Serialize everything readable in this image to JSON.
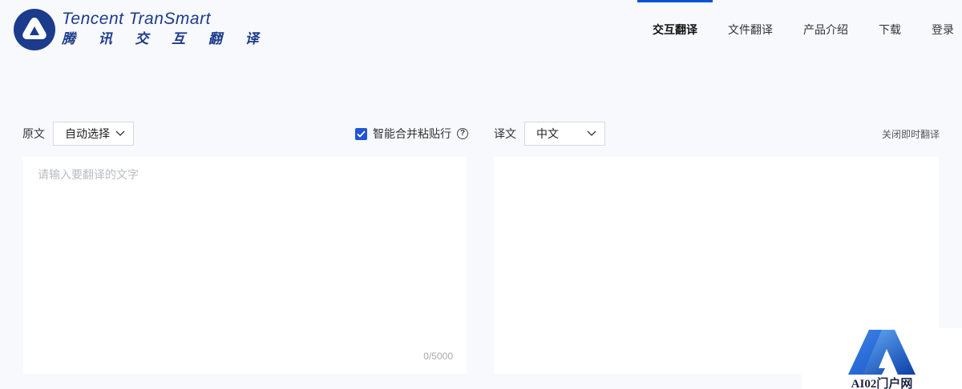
{
  "logo": {
    "en": "Tencent TranSmart",
    "cn": "腾 讯 交 互 翻 译"
  },
  "nav": {
    "items": [
      {
        "label": "交互翻译",
        "active": true
      },
      {
        "label": "文件翻译"
      },
      {
        "label": "产品介绍"
      },
      {
        "label": "下载"
      },
      {
        "label": "登录"
      }
    ]
  },
  "source": {
    "label": "原文",
    "language": "自动选择",
    "smart_merge_label": "智能合并粘贴行",
    "smart_merge_checked": true,
    "placeholder": "请输入要翻译的文字",
    "counter": "0/5000"
  },
  "target": {
    "label": "译文",
    "language": "中文",
    "close_instant": "关闭即时翻译"
  },
  "colors": {
    "accent": "#0052d9",
    "logo_blue": "#1c3b8c",
    "background": "#f7f9fd"
  },
  "watermark": {
    "text": "AI02门户网"
  }
}
